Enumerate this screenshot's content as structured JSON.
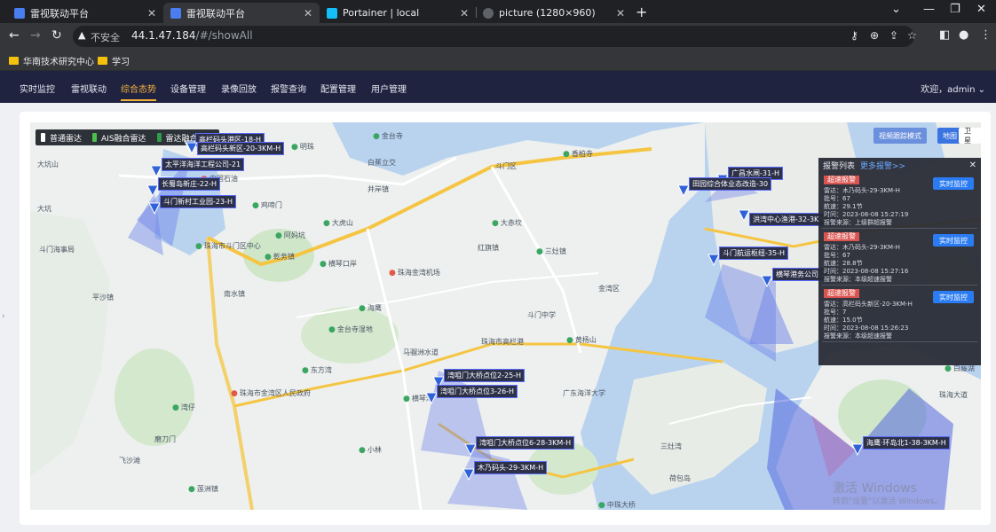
{
  "browser": {
    "tabs": [
      {
        "label": "雷视联动平台",
        "icon_color": "#4a7df0"
      },
      {
        "label": "雷视联动平台",
        "icon_color": "#4a7df0"
      },
      {
        "label": "Portainer | local",
        "icon_color": "#13bef9"
      },
      {
        "label": "picture (1280×960)",
        "icon_color": "#9aa0a6"
      }
    ],
    "address": {
      "insecure_label": "不安全",
      "host": "44.1.47.184",
      "path": "/#/showAll"
    },
    "bookmarks": [
      {
        "label": "华南技术研究中心"
      },
      {
        "label": "学习"
      }
    ]
  },
  "app": {
    "nav": [
      {
        "label": "实时监控"
      },
      {
        "label": "雷视联动"
      },
      {
        "label": "综合态势",
        "active": true
      },
      {
        "label": "设备管理"
      },
      {
        "label": "录像回放"
      },
      {
        "label": "报警查询"
      },
      {
        "label": "配置管理"
      },
      {
        "label": "用户管理"
      }
    ],
    "user": "欢迎，admin ⌄"
  },
  "map": {
    "legend": [
      {
        "label": "普通雷达",
        "color": "#ffffff"
      },
      {
        "label": "AIS融合雷达",
        "color": "#4cc04c"
      },
      {
        "label": "雷达融合雷达",
        "color": "#2e9e4a"
      }
    ],
    "buttons": {
      "track": "视频跟踪模式",
      "map": "地图",
      "satellite": "卫星"
    },
    "radars": [
      {
        "label": "高栏码头港区-18-H"
      },
      {
        "label": "太平洋海洋工程公司-21"
      },
      {
        "label": "长蜀岛新庄-22-H"
      },
      {
        "label": "斗门新村工业园-23-H"
      },
      {
        "label": "高栏码头新区-20-3KM-H"
      },
      {
        "label": "广昌水闸-31-H"
      },
      {
        "label": "田园综合体业态改造-30"
      },
      {
        "label": "洪湾中心渔港-32-3KM-H"
      },
      {
        "label": "斗门航运枢纽-35-H"
      },
      {
        "label": "横琴港务公司-2"
      },
      {
        "label": "湾咀门大桥点位2-25-H"
      },
      {
        "label": "湾咀门大桥点位3-26-H"
      },
      {
        "label": "湾咀门大桥点位6-28-3KM-H"
      },
      {
        "label": "木乃码头-29-3KM-H"
      },
      {
        "label": "海鹰·环岛北1-38-3KM-H"
      }
    ],
    "pois": [
      "金台寺",
      "明珠",
      "大坑山",
      "白蕉立交",
      "斗门区",
      "中国石油",
      "香柏寺",
      "井岸镇",
      "大坑",
      "鸡啼门",
      "大虎山",
      "阿妈坑",
      "大赤坎",
      "斗门海事局",
      "珠海市斗门区中心",
      "乾务镇",
      "横琴口岸",
      "红旗镇",
      "三灶镇",
      "金湾区",
      "珠海金湾机场",
      "平沙镇",
      "南水镇",
      "海鹰",
      "斗门中学",
      "珠海市高栏港",
      "金台寺湿地",
      "黄杨山",
      "马骝洲水道",
      "珠海市金湾区人民政府",
      "东方湾",
      "广东海洋大学",
      "湾仔",
      "磨刀门",
      "横琴湾",
      "飞沙滩",
      "三灶湾",
      "小林",
      "荷包岛",
      "莲洲镇",
      "白藤湖",
      "珠海大道",
      "中珠大桥"
    ],
    "watermark": [
      "激活 Windows",
      "转到\"设置\"以激活 Windows。"
    ]
  },
  "alerts": {
    "title": "报警列表",
    "more": "更多报警>>",
    "items": [
      {
        "badge": "超速报警",
        "radar": "雷达：木乃码头-29-3KM-H",
        "no": "批号：67",
        "speed": "航速：29.1节",
        "time": "时间：2023-08-08 15:27:19",
        "source": "报警来源：上级群超报警",
        "action": "实时监控"
      },
      {
        "badge": "超速报警",
        "radar": "雷达：木乃码头-29-3KM-H",
        "no": "批号：67",
        "speed": "航速：28.8节",
        "time": "时间：2023-08-08 15:27:16",
        "source": "报警来源：本级超速报警",
        "action": "实时监控"
      },
      {
        "badge": "超速报警",
        "radar": "雷达：高栏码头新区-20-3KM-H",
        "no": "批号：7",
        "speed": "航速：15.0节",
        "time": "时间：2023-08-08 15:26:23",
        "source": "报警来源：本级超速报警",
        "action": "实时监控"
      }
    ]
  }
}
